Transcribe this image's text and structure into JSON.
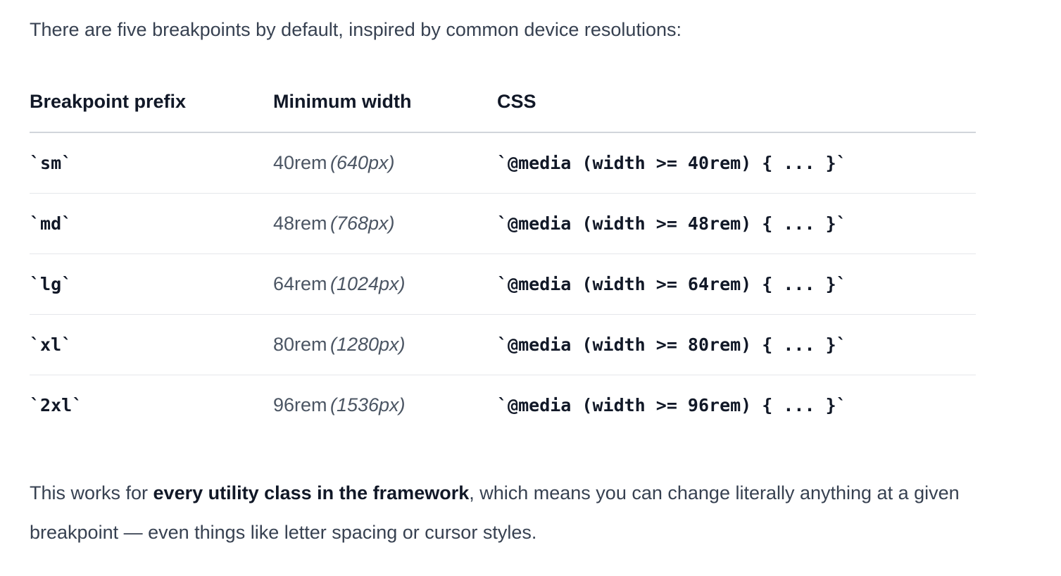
{
  "intro": "There are five breakpoints by default, inspired by common device resolutions:",
  "table": {
    "headers": [
      "Breakpoint prefix",
      "Minimum width",
      "CSS"
    ],
    "rows": [
      {
        "prefix": "`sm`",
        "min_rem": "40rem",
        "min_px": "(640px)",
        "css": "`@media (width >= 40rem) { ... }`"
      },
      {
        "prefix": "`md`",
        "min_rem": "48rem",
        "min_px": "(768px)",
        "css": "`@media (width >= 48rem) { ... }`"
      },
      {
        "prefix": "`lg`",
        "min_rem": "64rem",
        "min_px": "(1024px)",
        "css": "`@media (width >= 64rem) { ... }`"
      },
      {
        "prefix": "`xl`",
        "min_rem": "80rem",
        "min_px": "(1280px)",
        "css": "`@media (width >= 80rem) { ... }`"
      },
      {
        "prefix": "`2xl`",
        "min_rem": "96rem",
        "min_px": "(1536px)",
        "css": "`@media (width >= 96rem) { ... }`"
      }
    ]
  },
  "outro": {
    "before": "This works for ",
    "bold": "every utility class in the framework",
    "after": ", which means you can change literally anything at a given breakpoint — even things like letter spacing or cursor styles."
  }
}
